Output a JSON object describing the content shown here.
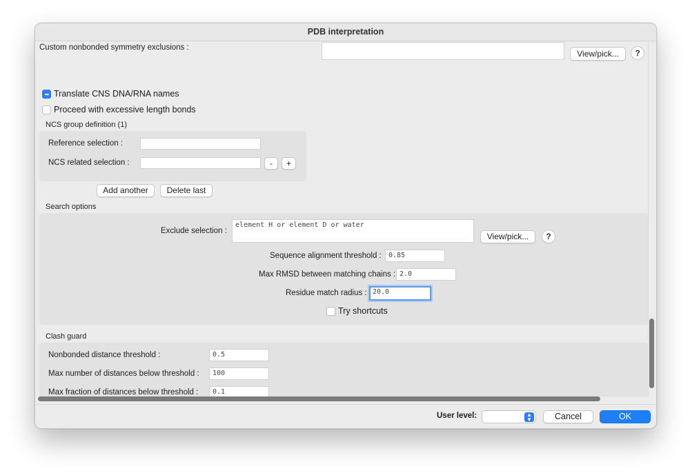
{
  "window": {
    "title": "PDB interpretation"
  },
  "symmetry": {
    "label": "Custom nonbonded symmetry exclusions :",
    "value": "",
    "view_pick": "View/pick...",
    "help": "?"
  },
  "checkboxes": {
    "translate_cns": {
      "label": "Translate CNS DNA/RNA names",
      "checked": true
    },
    "excessive_bonds": {
      "label": "Proceed with excessive length bonds",
      "checked": false
    }
  },
  "ncs": {
    "header": "NCS group definition (1)",
    "reference_label": "Reference selection :",
    "reference_value": "",
    "related_label": "NCS related selection :",
    "related_value": "",
    "minus": "-",
    "plus": "+",
    "add_another": "Add another",
    "delete_last": "Delete last"
  },
  "search": {
    "header": "Search options",
    "exclude_label": "Exclude selection :",
    "exclude_value": "element H or element D or water",
    "view_pick": "View/pick...",
    "help": "?",
    "seq_label": "Sequence alignment threshold :",
    "seq_value": "0.85",
    "rmsd_label": "Max RMSD between matching chains :",
    "rmsd_value": "2.0",
    "radius_label": "Residue match radius :",
    "radius_value": "20.0",
    "shortcuts_label": "Try shortcuts",
    "shortcuts_checked": false
  },
  "clash": {
    "header": "Clash guard",
    "nonbonded_label": "Nonbonded distance threshold :",
    "nonbonded_value": "0.5",
    "maxnum_label": "Max number of distances below threshold :",
    "maxnum_value": "100",
    "maxfrac_label": "Max fraction of distances below threshold :",
    "maxfrac_value": "0.1"
  },
  "footer": {
    "user_level_label": "User level:",
    "user_level_value": "",
    "cancel": "Cancel",
    "ok": "OK"
  },
  "icons": {
    "select_arrows": "select-arrows-icon",
    "help": "help-icon"
  },
  "colors": {
    "accent": "#1e7ff7",
    "focus_ring": "#5b9bf0",
    "panel": "#e2e2e2",
    "window": "#ececec"
  }
}
